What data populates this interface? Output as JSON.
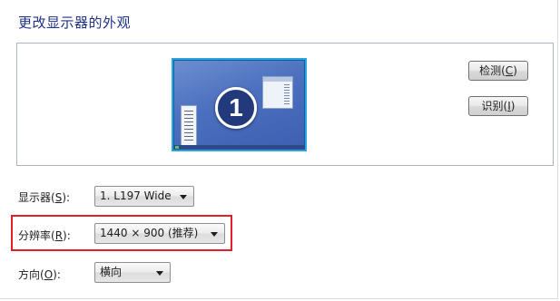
{
  "page": {
    "title": "更改显示器的外观"
  },
  "preview": {
    "monitor_number": "1",
    "detect_label": "检测(C)",
    "detect_text": "检测(",
    "detect_key": "C",
    "detect_close": ")",
    "identify_text": "识别(",
    "identify_key": "I",
    "identify_close": ")"
  },
  "display": {
    "label_text": "显示器(",
    "label_key": "S",
    "label_close": "):",
    "value": "1. L197 Wide"
  },
  "resolution": {
    "label_text": "分辨率(",
    "label_key": "R",
    "label_close": "):",
    "value": "1440 × 900 (推荐)"
  },
  "orientation": {
    "label_text": "方向(",
    "label_key": "O",
    "label_close": "):",
    "value": "横向"
  },
  "colors": {
    "title": "#1e3287",
    "highlight": "#e0202a",
    "monitor_border": "#27a5e0"
  },
  "icons": {
    "dropdown": "chevron-down-icon",
    "monitor": "monitor-icon"
  }
}
